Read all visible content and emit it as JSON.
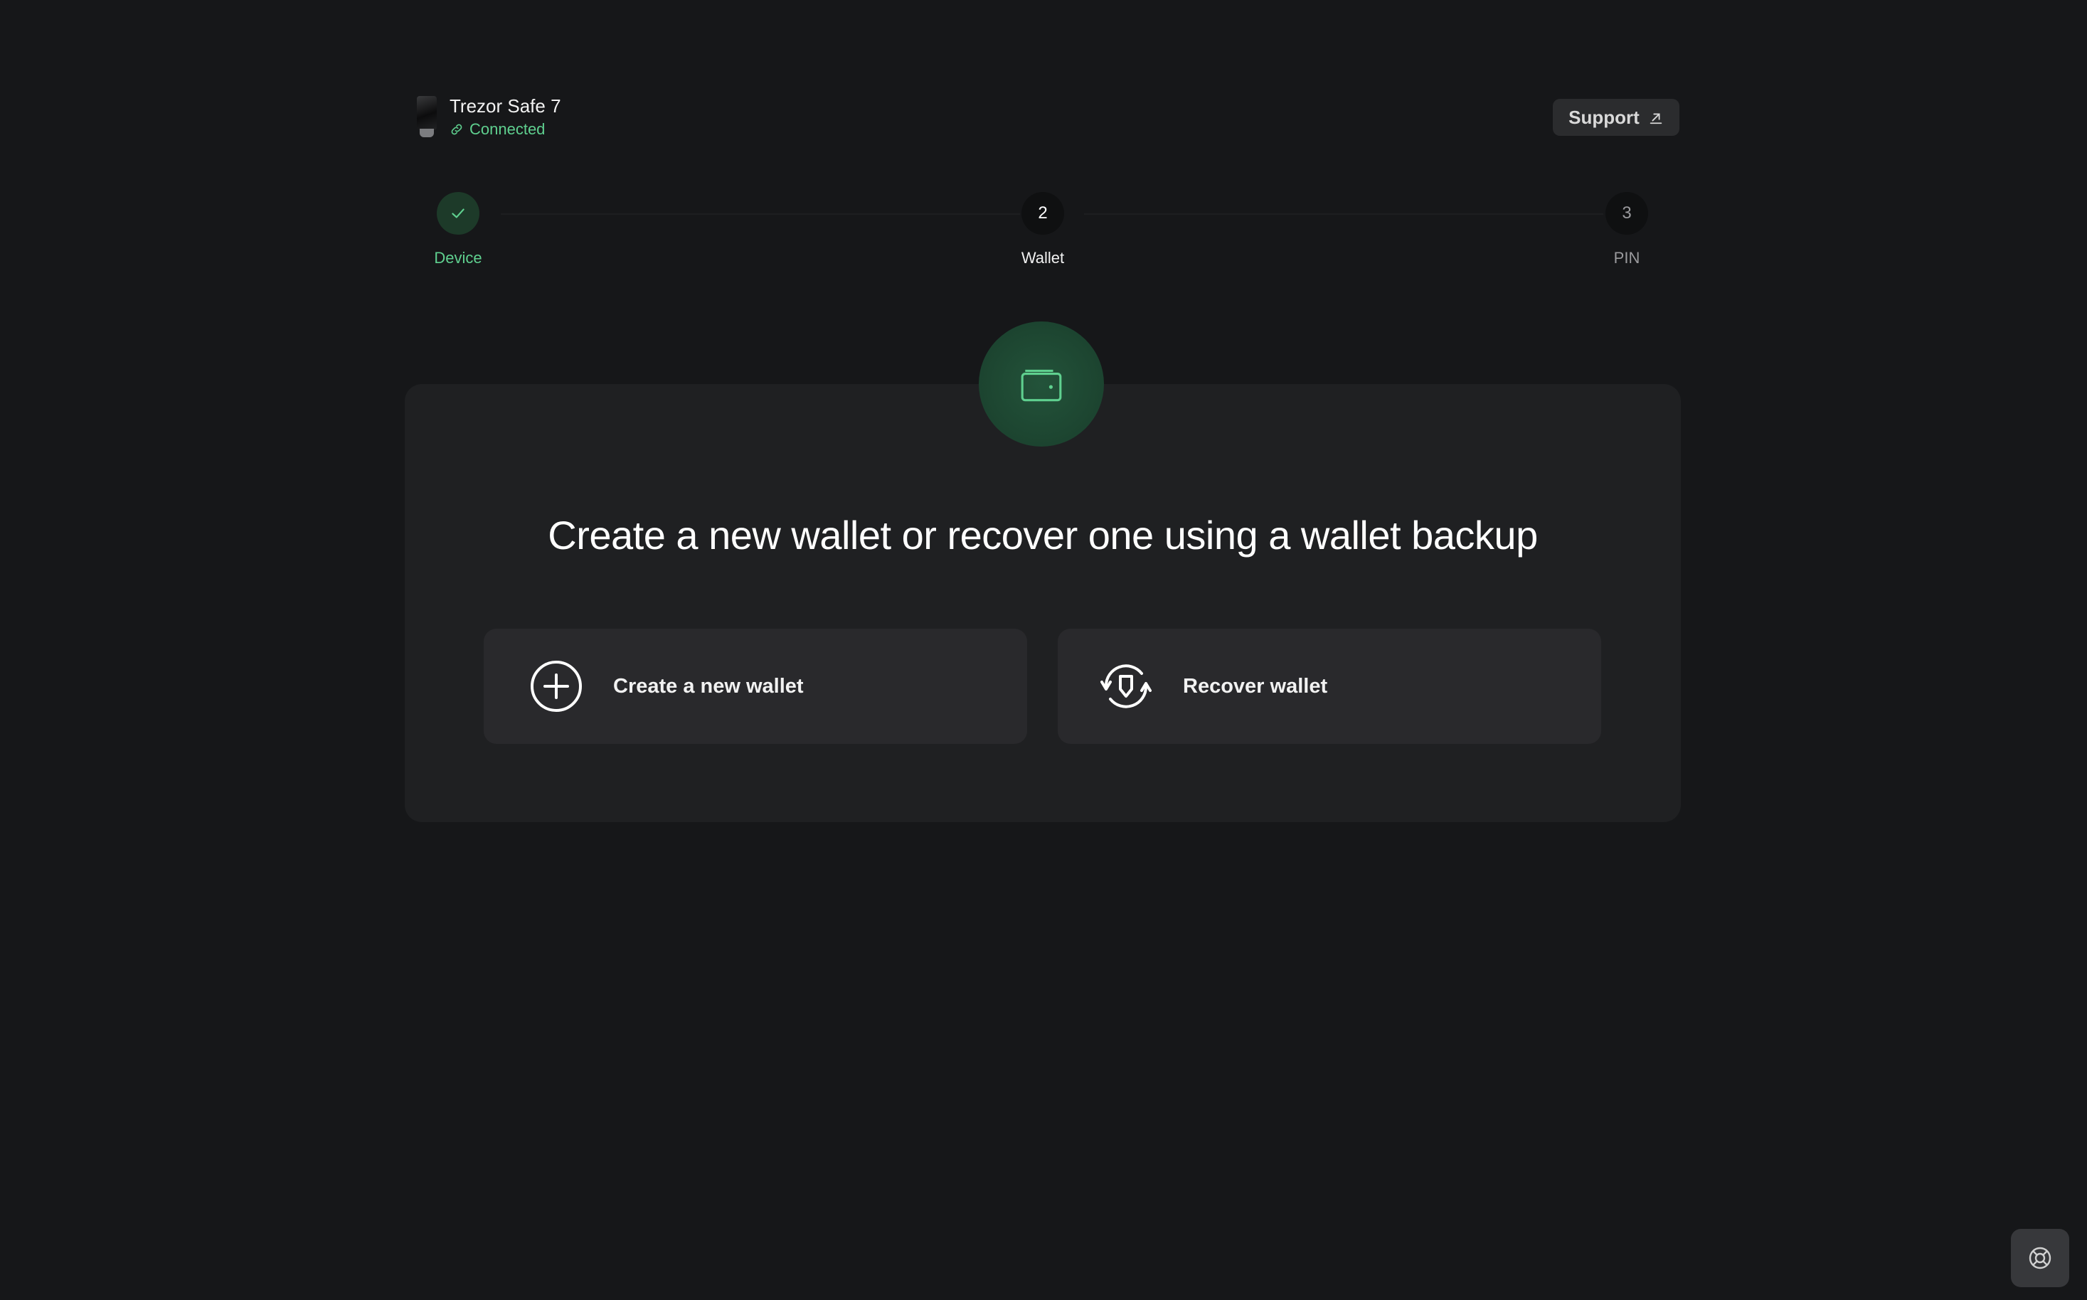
{
  "header": {
    "device_name": "Trezor Safe 7",
    "device_status": "Connected",
    "support_label": "Support"
  },
  "stepper": {
    "steps": [
      {
        "label": "Device",
        "number": "",
        "state": "complete"
      },
      {
        "label": "Wallet",
        "number": "2",
        "state": "active"
      },
      {
        "label": "PIN",
        "number": "3",
        "state": "upcoming"
      }
    ]
  },
  "main": {
    "hero_icon": "wallet-icon",
    "headline": "Create a new wallet or recover one using a wallet backup",
    "options": [
      {
        "label": "Create a new wallet",
        "icon": "plus-circle-icon"
      },
      {
        "label": "Recover wallet",
        "icon": "shield-recover-icon"
      }
    ]
  },
  "help": {
    "icon": "lifebuoy-icon"
  },
  "colors": {
    "background": "#161719",
    "card": "#1f2022",
    "option": "#29292c",
    "accent_green": "#5fd08f",
    "hero_bg": "#1d4631"
  }
}
